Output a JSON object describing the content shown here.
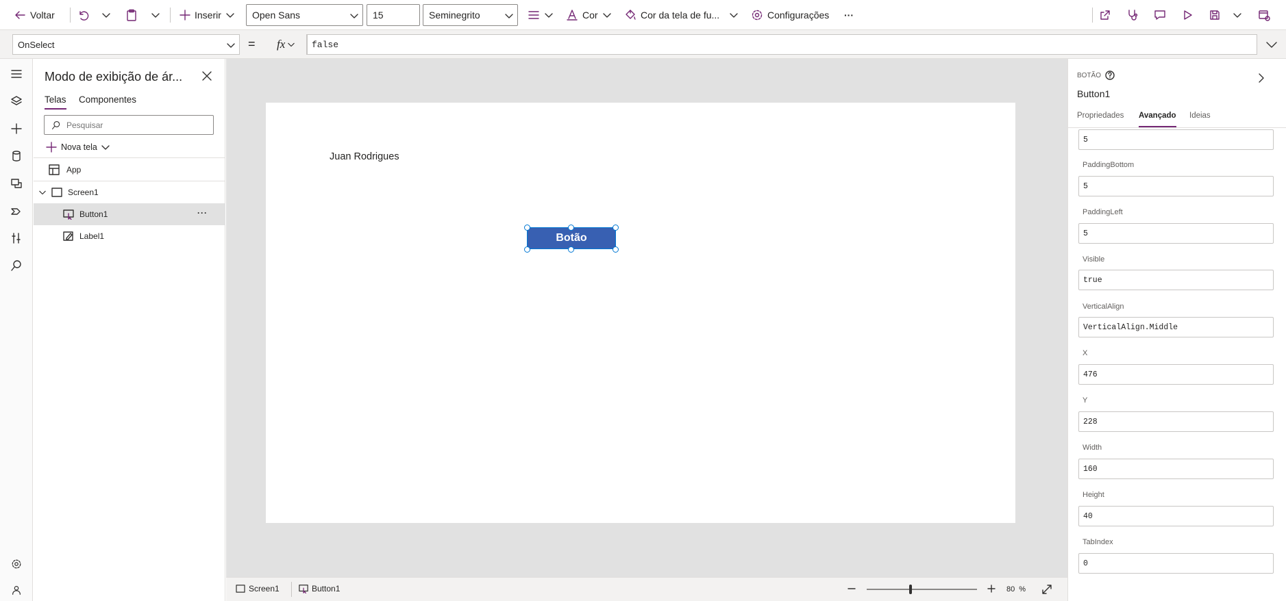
{
  "toolbar": {
    "back_label": "Voltar",
    "insert_label": "Inserir",
    "font_value": "Open Sans",
    "font_size_value": "15",
    "font_weight_value": "Seminegrito",
    "color_label": "Cor",
    "fill_label": "Cor da tela de fu...",
    "settings_label": "Configurações",
    "more_label": "···"
  },
  "formula": {
    "property": "OnSelect",
    "equals": "=",
    "fx": "fx",
    "value": "false"
  },
  "tree": {
    "title": "Modo de exibição de ár...",
    "tabs": [
      "Telas",
      "Componentes"
    ],
    "search_placeholder": "Pesquisar",
    "new_screen_label": "Nova tela",
    "items": [
      {
        "label": "App",
        "icon": "app-icon"
      },
      {
        "label": "Screen1",
        "icon": "screen-icon"
      },
      {
        "label": "Button1",
        "icon": "button-control-icon"
      },
      {
        "label": "Label1",
        "icon": "label-control-icon"
      }
    ],
    "item_more": "···"
  },
  "canvas": {
    "label_text": "Juan Rodrigues",
    "button_text": "Botão"
  },
  "status": {
    "screen_crumb": "Screen1",
    "button_crumb": "Button1",
    "zoom_value": "80",
    "zoom_unit": "%",
    "zoom_fraction": 0.4
  },
  "props": {
    "kind": "BOTÃO",
    "name": "Button1",
    "tabs": [
      "Propriedades",
      "Avançado",
      "Ideias"
    ],
    "fields": [
      {
        "label": "",
        "value": "5"
      },
      {
        "label": "PaddingBottom",
        "value": "5"
      },
      {
        "label": "PaddingLeft",
        "value": "5"
      },
      {
        "label": "Visible",
        "value": "true"
      },
      {
        "label": "VerticalAlign",
        "value": "VerticalAlign.Middle"
      },
      {
        "label": "X",
        "value": "476"
      },
      {
        "label": "Y",
        "value": "228"
      },
      {
        "label": "Width",
        "value": "160"
      },
      {
        "label": "Height",
        "value": "40"
      },
      {
        "label": "TabIndex",
        "value": "0"
      }
    ]
  },
  "colors": {
    "accent": "#742774",
    "button_fill": "#3860b2",
    "selection": "#0078d4"
  }
}
